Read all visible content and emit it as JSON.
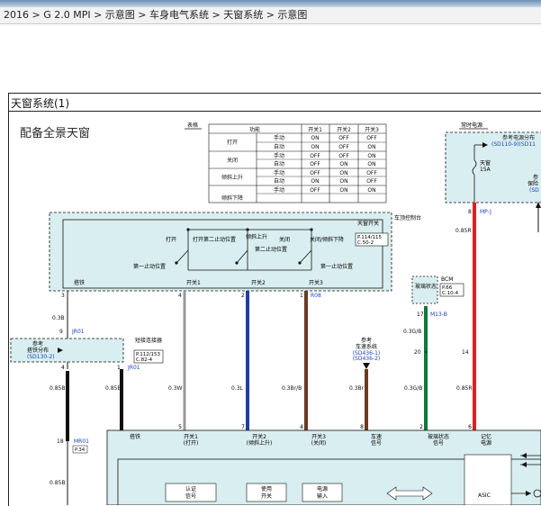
{
  "breadcrumb": "2016 > G 2.0 MPI > 示意图 > 车身电气系统 > 天窗系统 > 示意图",
  "diagram_title": "天窗系统(1)",
  "subtitle": "配备全景天窗",
  "table": {
    "label": "表格",
    "headers": [
      "功能",
      "开关1",
      "开关2",
      "开关3"
    ],
    "groups": [
      {
        "name": "打开",
        "rows": [
          [
            "手动",
            "ON",
            "OFF",
            "OFF"
          ],
          [
            "自动",
            "ON",
            "OFF",
            "ON"
          ]
        ]
      },
      {
        "name": "关闭",
        "rows": [
          [
            "手动",
            "OFF",
            "OFF",
            "ON"
          ],
          [
            "自动",
            "OFF",
            "ON",
            "ON"
          ]
        ]
      },
      {
        "name": "倾斜上升",
        "rows": [
          [
            "手动",
            "OFF",
            "ON",
            "OFF"
          ],
          [
            "自动",
            "ON",
            "ON",
            "OFF"
          ]
        ]
      },
      {
        "name": "倾斜下降",
        "rows": [
          [
            "手动",
            "OFF",
            "ON",
            "ON"
          ]
        ]
      }
    ]
  },
  "fuse_box": {
    "title": "常时电源",
    "ref": "参考电源分布",
    "ref_link": "(SD110-9)(SD11",
    "fuse_name": "天窗",
    "fuse_amp": "15A",
    "right_ref": "参",
    "right_ref2": "保险",
    "right_ref3": "(SD"
  },
  "overhead": {
    "module": "车顶控制台",
    "switch_name": "天窗开关",
    "switch_pages": "P.114/115",
    "switch_code": "C.50-2",
    "labels": {
      "open": "打开",
      "open_stop2": "打开第二止动位置",
      "tilt_up": "倾斜上升",
      "close": "关闭",
      "stop2": "第二止动位置",
      "close_tilt_down": "关闭/倾斜下降",
      "stop1_left": "第一止动位置",
      "stop1_right": "第一止动位置"
    }
  },
  "bottom_labels": {
    "ground": "搭铁",
    "sw1": "开关1",
    "sw2": "开关2",
    "sw3": "开关3"
  },
  "connectors": {
    "r08": "R08",
    "jr01_top": "JR01",
    "jr01_mid": "JR01",
    "m13b": "M13-B",
    "mpj": "MP-J",
    "mr01": "MR01",
    "p34": "P.34",
    "pin3": "3",
    "pin4": "4",
    "pin2": "2",
    "pin1": "1",
    "pin9": "9",
    "pin4b": "4",
    "pin1b": "1",
    "pin17": "17",
    "pin20": "20",
    "pin14": "14",
    "pin8": "8",
    "pin18": "18"
  },
  "ground_ref": {
    "title": "参考",
    "name": "搭铁分布",
    "link": "(SD130-2)"
  },
  "joint": {
    "name": "短接连接器",
    "pages": "P.112/153",
    "code": "C.82-4"
  },
  "speed_ref": {
    "title": "参考",
    "name": "车速系统",
    "link1": "(SD436-1)",
    "link2": "(SD436-2)"
  },
  "bcm": {
    "name": "BCM",
    "page": "P.66",
    "code": "C.10-4",
    "label": "玻璃状态"
  },
  "wires": {
    "w03b": "0.3B",
    "w085r_top": "0.85R",
    "w085b_left": "0.85B",
    "w085b_mid": "0.85B",
    "w03w": "0.3W",
    "w03l": "0.3L",
    "w03brb": "0.3Br/B",
    "w03br": "0.3Br",
    "w03gb_top": "0.3G/B",
    "w03gb": "0.3G/B",
    "w085r": "0.85R",
    "w085b_low": "0.85B"
  },
  "lower_module": {
    "pins": [
      "1",
      "5",
      "7",
      "4",
      "8",
      "2",
      "6"
    ],
    "labels": [
      [
        "搭铁",
        ""
      ],
      [
        "开关1",
        "(打开)"
      ],
      [
        "开关2",
        "(倾斜上升)"
      ],
      [
        "开关3",
        "(关闭)"
      ],
      [
        "车速",
        "信号"
      ],
      [
        "玻璃状态",
        "信号"
      ],
      [
        "记忆",
        "电源"
      ]
    ],
    "boxes": [
      [
        "认证",
        "信号"
      ],
      [
        "使用",
        "开关"
      ],
      [
        "电源",
        "输入"
      ]
    ],
    "asic": "ASIC"
  }
}
